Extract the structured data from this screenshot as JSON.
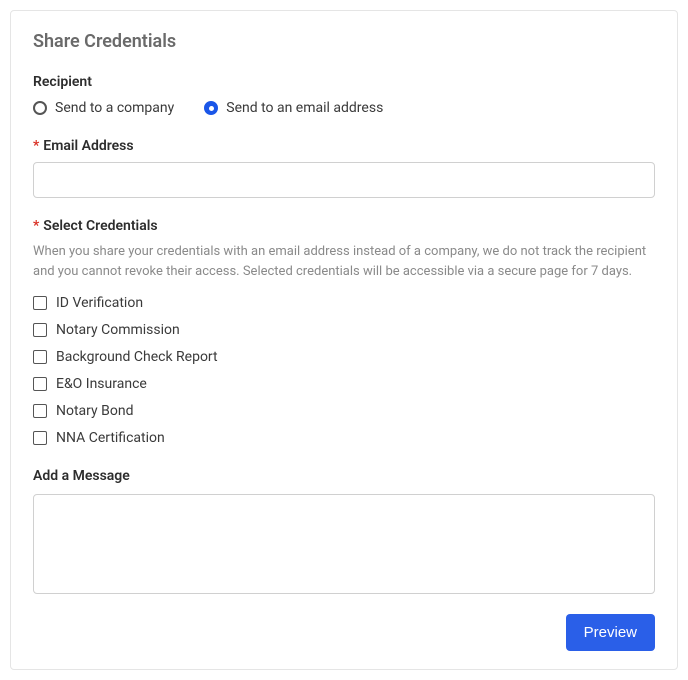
{
  "title": "Share Credentials",
  "recipient": {
    "label": "Recipient",
    "options": {
      "company": "Send to a company",
      "email": "Send to an email address"
    },
    "selected": "email"
  },
  "emailField": {
    "label": "Email Address",
    "value": ""
  },
  "credentials": {
    "label": "Select Credentials",
    "helper": "When you share your credentials with an email address instead of a company, we do not track the recipient and you cannot revoke their access. Selected credentials will be accessible via a secure page for 7 days.",
    "items": [
      "ID Verification",
      "Notary Commission",
      "Background Check Report",
      "E&O Insurance",
      "Notary Bond",
      "NNA Certification"
    ]
  },
  "message": {
    "label": "Add a Message",
    "value": ""
  },
  "buttons": {
    "preview": "Preview"
  }
}
